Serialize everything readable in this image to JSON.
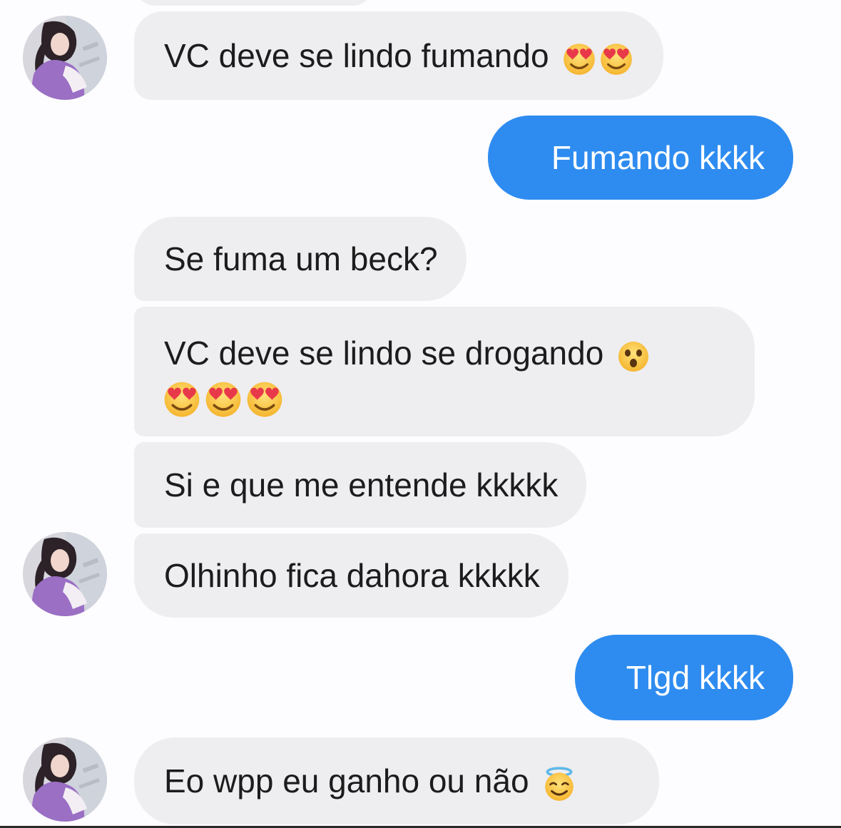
{
  "messages": [
    {
      "id": "m1",
      "side": "in",
      "text": "VC deve se lindo fumando",
      "emojis": [
        "heart-eyes",
        "heart-eyes"
      ]
    },
    {
      "id": "m2",
      "side": "out",
      "text": "Fumando kkkk"
    },
    {
      "id": "m3",
      "side": "in",
      "text": "Se fuma um beck?"
    },
    {
      "id": "m4",
      "side": "in",
      "text": "VC deve se lindo se drogando",
      "emojis": [
        "astonished",
        "heart-eyes",
        "heart-eyes",
        "heart-eyes"
      ]
    },
    {
      "id": "m5",
      "side": "in",
      "text": "Si e que me entende kkkkk"
    },
    {
      "id": "m6",
      "side": "in",
      "text": "Olhinho fica dahora kkkkk"
    },
    {
      "id": "m7",
      "side": "out",
      "text": "Tlgd kkkk"
    },
    {
      "id": "m8",
      "side": "in",
      "text": "Eo wpp eu ganho ou não",
      "emojis": [
        "innocent-halo"
      ]
    }
  ],
  "colors": {
    "outgoing_bubble": "#2e8cf0",
    "incoming_bubble": "#eeedf0",
    "background": "#fdfcfe"
  }
}
